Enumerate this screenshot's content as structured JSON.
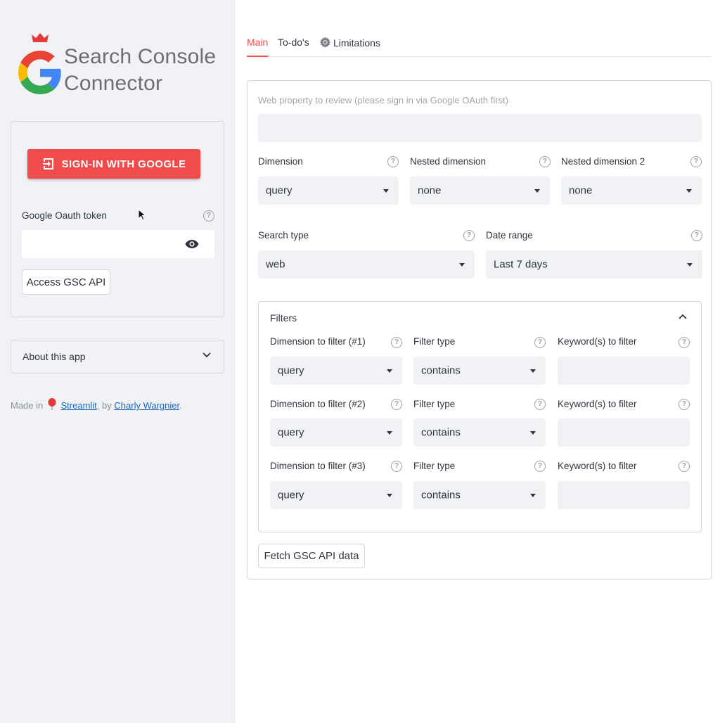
{
  "sidebar": {
    "logo_line1": "Search Console",
    "logo_line2": "Connector",
    "signin_label": "SIGN-IN WITH GOOGLE",
    "token_label": "Google Oauth token",
    "token_value": "",
    "access_button": "Access GSC API",
    "about_label": "About this app",
    "made_in_prefix": "Made in",
    "streamlit_link": "Streamlit",
    "by_text": ", by",
    "author_link": "Charly Wargnier",
    "period": "."
  },
  "tabs": [
    {
      "label": "Main",
      "active": true
    },
    {
      "label": "To-do's",
      "active": false
    },
    {
      "label": "Limitations",
      "icon": "gear-icon",
      "active": false
    }
  ],
  "main": {
    "property_placeholder": "Web property to review (please sign in via Google OAuth first)",
    "property_value": "",
    "dimension_label": "Dimension",
    "dimension_value": "query",
    "nested_label": "Nested dimension",
    "nested_value": "none",
    "nested2_label": "Nested dimension 2",
    "nested2_value": "none",
    "search_type_label": "Search type",
    "search_type_value": "web",
    "date_range_label": "Date range",
    "date_range_value": "Last 7 days",
    "filters_title": "Filters",
    "filters": [
      {
        "dim_label": "Dimension to filter (#1)",
        "dim_value": "query",
        "type_label": "Filter type",
        "type_value": "contains",
        "kw_label": "Keyword(s) to filter",
        "kw_value": ""
      },
      {
        "dim_label": "Dimension to filter (#2)",
        "dim_value": "query",
        "type_label": "Filter type",
        "type_value": "contains",
        "kw_label": "Keyword(s) to filter",
        "kw_value": ""
      },
      {
        "dim_label": "Dimension to filter (#3)",
        "dim_value": "query",
        "type_label": "Filter type",
        "type_value": "contains",
        "kw_label": "Keyword(s) to filter",
        "kw_value": ""
      }
    ],
    "fetch_button": "Fetch GSC API data"
  },
  "colors": {
    "accent": "#f14c4c",
    "sidebar_bg": "#f0f2f6",
    "link": "#1c6ab8"
  },
  "help_glyph": "?"
}
